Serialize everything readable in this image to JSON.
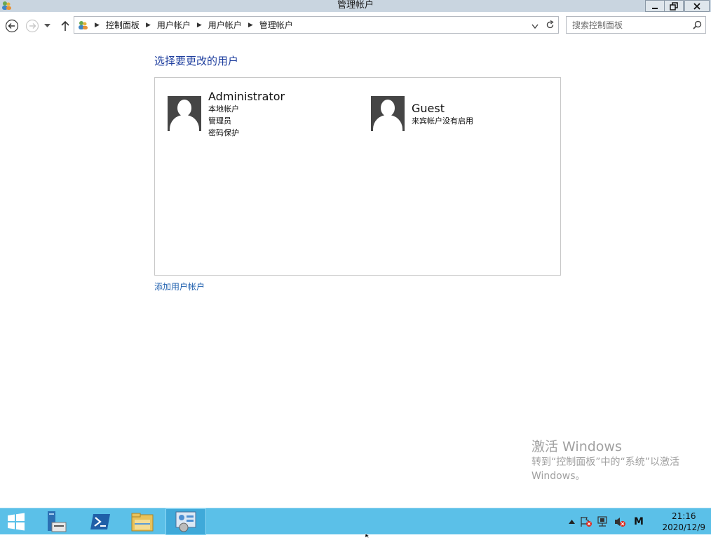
{
  "window": {
    "title": "管理帐户",
    "minimize_icon": "minimize-icon",
    "restore_icon": "restore-icon",
    "close_icon": "close-icon"
  },
  "addressbar": {
    "breadcrumbs": [
      "控制面板",
      "用户帐户",
      "用户帐户",
      "管理帐户"
    ],
    "search_placeholder": "搜索控制面板"
  },
  "main": {
    "heading": "选择要更改的用户",
    "users": [
      {
        "name": "Administrator",
        "lines": [
          "本地帐户",
          "管理员",
          "密码保护"
        ]
      },
      {
        "name": "Guest",
        "lines": [
          "来宾帐户没有启用"
        ]
      }
    ],
    "add_link": "添加用户帐户"
  },
  "watermark": {
    "title": "激活 Windows",
    "line1": "转到“控制面板”中的“系统”以激活",
    "line2": "Windows。"
  },
  "taskbar": {
    "ime": "M",
    "time": "21:16",
    "date": "2020/12/9"
  },
  "colors": {
    "heading": "#1e3e9e",
    "link": "#1e5fae",
    "taskbar": "#5bc0e8",
    "titlebar": "#c9d5e0"
  }
}
